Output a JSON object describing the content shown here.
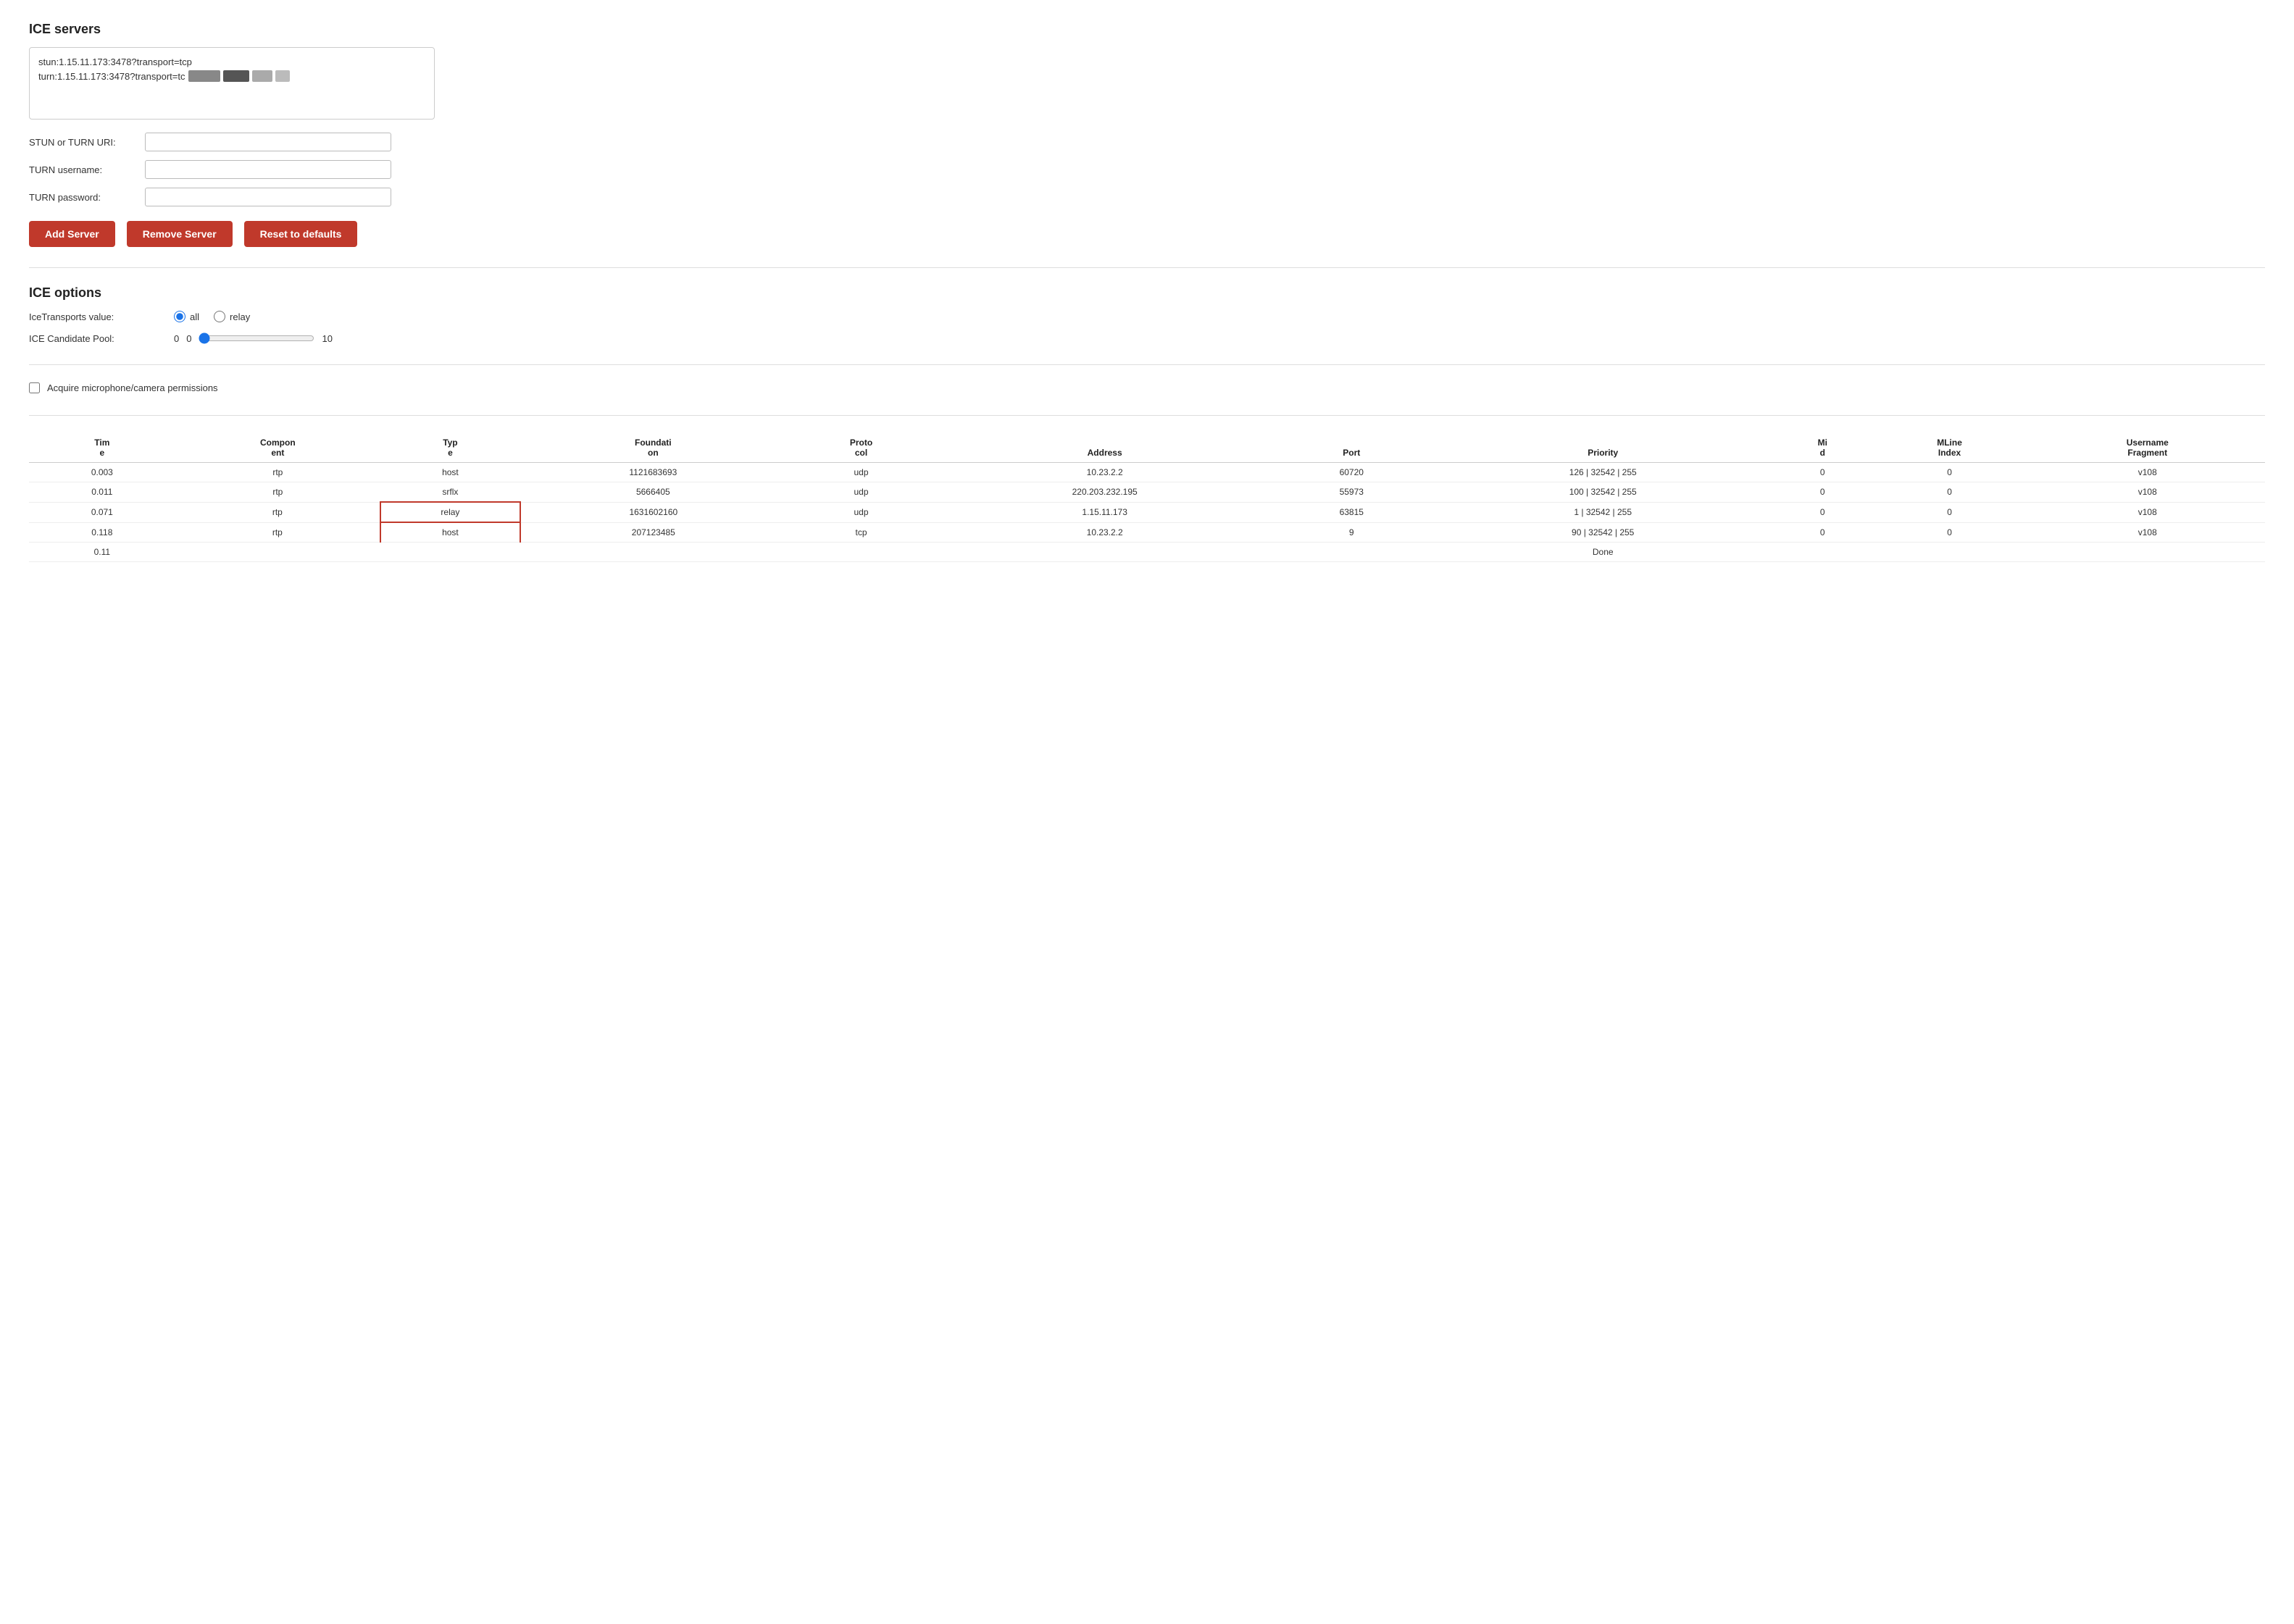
{
  "ice_servers": {
    "section_title": "ICE servers",
    "server_lines": [
      "stun:1.15.11.173:3478?transport=tcp",
      "turn:1.15.11.173:3478?transport=tc"
    ],
    "stun_label": "STUN or TURN URI:",
    "turn_user_label": "TURN username:",
    "turn_pass_label": "TURN password:",
    "stun_placeholder": "",
    "turn_user_placeholder": "",
    "turn_pass_placeholder": "",
    "btn_add": "Add Server",
    "btn_remove": "Remove Server",
    "btn_reset": "Reset to defaults"
  },
  "ice_options": {
    "section_title": "ICE options",
    "transports_label": "IceTransports value:",
    "transports_options": [
      "all",
      "relay"
    ],
    "transports_selected": "all",
    "pool_label": "ICE Candidate Pool:",
    "pool_value": "0",
    "pool_min": "0",
    "pool_max": "10",
    "pool_current": 0
  },
  "acquire": {
    "label": "Acquire microphone/camera permissions",
    "checked": false
  },
  "candidates_table": {
    "columns": [
      "Time",
      "Component",
      "Type",
      "Foundation",
      "Protocol",
      "Address",
      "Port",
      "Priority",
      "Mid",
      "MLine Index",
      "Username Fragment"
    ],
    "col_headers": [
      "Tim e",
      "Compon ent",
      "Typ e",
      "Foundati on",
      "Proto col",
      "Address",
      "Port",
      "Priority",
      "Mi d",
      "MLine Index",
      "Username Fragment"
    ],
    "rows": [
      {
        "time": "0.003",
        "component": "rtp",
        "type": "host",
        "foundation": "1121683693",
        "protocol": "udp",
        "address": "10.23.2.2",
        "port": "60720",
        "priority": "126 | 32542 | 255",
        "mid": "0",
        "mline_index": "0",
        "username_fragment": "v108",
        "highlight_type": false
      },
      {
        "time": "0.011",
        "component": "rtp",
        "type": "srflx",
        "foundation": "5666405",
        "protocol": "udp",
        "address": "220.203.232.195",
        "port": "55973",
        "priority": "100 | 32542 | 255",
        "mid": "0",
        "mline_index": "0",
        "username_fragment": "v108",
        "highlight_type": false
      },
      {
        "time": "0.071",
        "component": "rtp",
        "type": "relay",
        "foundation": "1631602160",
        "protocol": "udp",
        "address": "1.15.11.173",
        "port": "63815",
        "priority": "1 | 32542 | 255",
        "mid": "0",
        "mline_index": "0",
        "username_fragment": "v108",
        "highlight_type": true
      },
      {
        "time": "0.118",
        "component": "rtp",
        "type": "host",
        "foundation": "207123485",
        "protocol": "tcp",
        "address": "10.23.2.2",
        "port": "9",
        "priority": "90 | 32542 | 255",
        "mid": "0",
        "mline_index": "0",
        "username_fragment": "v108",
        "highlight_type": true
      },
      {
        "time": "0.11",
        "component": "",
        "type": "",
        "foundation": "",
        "protocol": "",
        "address": "",
        "port": "",
        "priority": "Done",
        "mid": "",
        "mline_index": "",
        "username_fragment": "",
        "highlight_type": false
      }
    ]
  }
}
